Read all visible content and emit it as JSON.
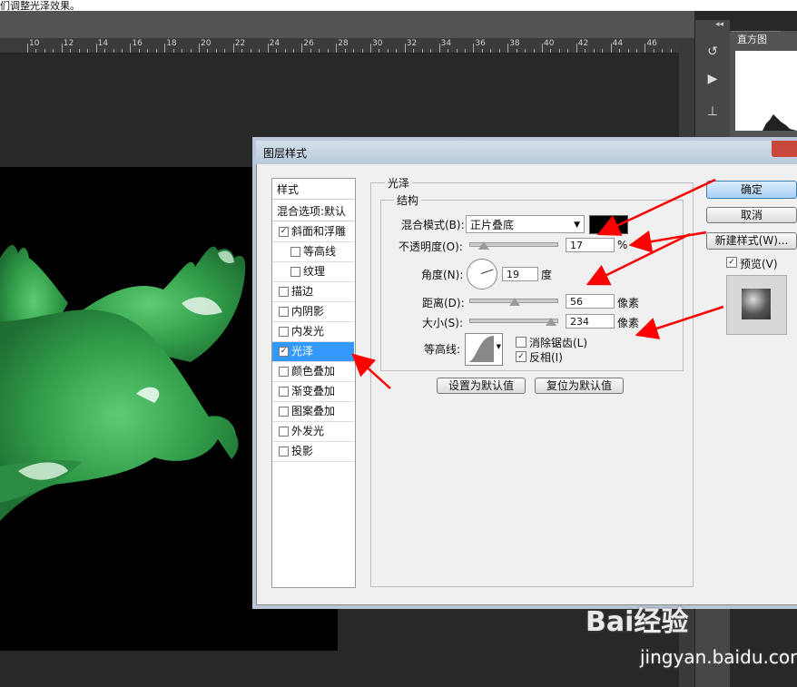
{
  "caption": "们调整光泽效果。",
  "ruler": {
    "ticks": [
      "10",
      "12",
      "14",
      "16",
      "18",
      "20",
      "22",
      "24",
      "26",
      "28",
      "30",
      "32",
      "34",
      "36",
      "38",
      "40",
      "42",
      "44",
      "46"
    ]
  },
  "panel": {
    "histogram_tab": "直方图",
    "collapse": "◂◂"
  },
  "dialog": {
    "title": "图层样式",
    "styles_header": "样式",
    "blend_options": "混合选项:默认",
    "items": [
      {
        "label": "斜面和浮雕",
        "checked": true,
        "indent": false
      },
      {
        "label": "等高线",
        "checked": false,
        "indent": true
      },
      {
        "label": "纹理",
        "checked": false,
        "indent": true
      },
      {
        "label": "描边",
        "checked": false,
        "indent": false
      },
      {
        "label": "内阴影",
        "checked": false,
        "indent": false
      },
      {
        "label": "内发光",
        "checked": false,
        "indent": false
      },
      {
        "label": "光泽",
        "checked": true,
        "indent": false,
        "selected": true
      },
      {
        "label": "颜色叠加",
        "checked": false,
        "indent": false
      },
      {
        "label": "渐变叠加",
        "checked": false,
        "indent": false
      },
      {
        "label": "图案叠加",
        "checked": false,
        "indent": false
      },
      {
        "label": "外发光",
        "checked": false,
        "indent": false
      },
      {
        "label": "投影",
        "checked": false,
        "indent": false
      }
    ],
    "section_title": "光泽",
    "structure_title": "结构",
    "blend_mode_label": "混合模式(B):",
    "blend_mode_value": "正片叠底",
    "blend_color": "#000000",
    "opacity_label": "不透明度(O):",
    "opacity_value": "17",
    "opacity_unit": "%",
    "angle_label": "角度(N):",
    "angle_value": "19",
    "angle_unit": "度",
    "distance_label": "距离(D):",
    "distance_value": "56",
    "distance_unit": "像素",
    "size_label": "大小(S):",
    "size_value": "234",
    "size_unit": "像素",
    "contour_label": "等高线:",
    "antialias_label": "消除锯齿(L)",
    "antialias_checked": false,
    "invert_label": "反相(I)",
    "invert_checked": true,
    "set_default": "设置为默认值",
    "reset_default": "复位为默认值",
    "ok": "确定",
    "cancel": "取消",
    "new_style": "新建样式(W)...",
    "preview_label": "预览(V)",
    "preview_checked": true
  },
  "watermark": {
    "brand": "Bai经验",
    "url": "jingyan.baidu.com"
  },
  "colors": {
    "accent_selection": "#3399ff",
    "arrow": "#ff0000",
    "dove": "#3fae5a"
  }
}
